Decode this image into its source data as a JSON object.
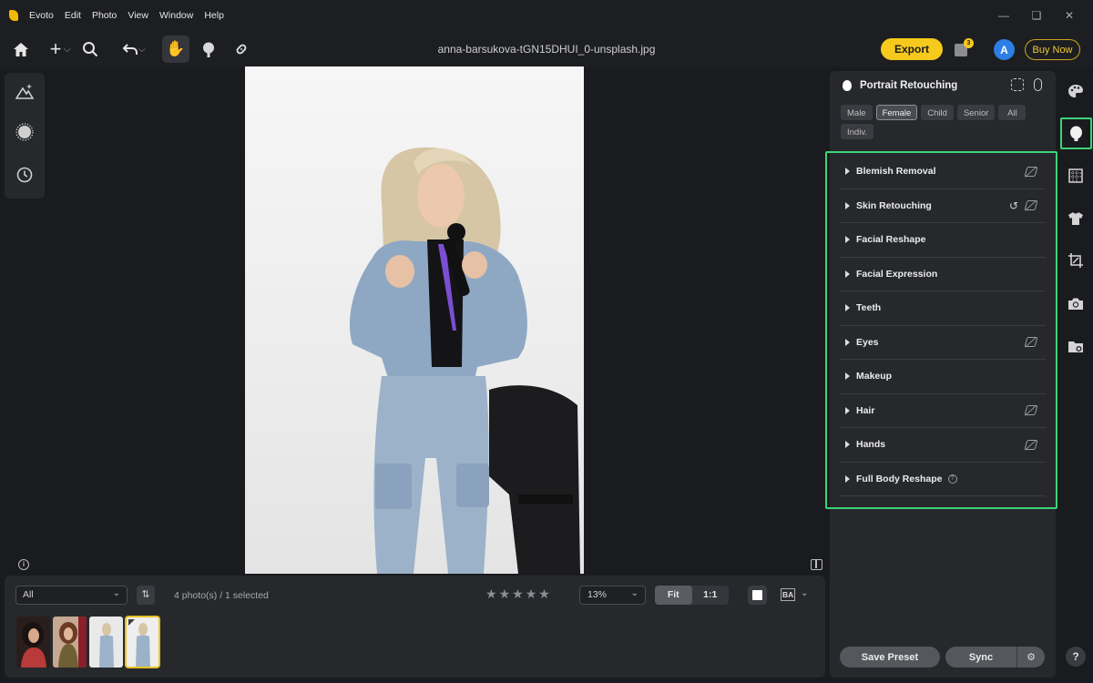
{
  "app": {
    "menu": [
      "Evoto",
      "Edit",
      "Photo",
      "View",
      "Window",
      "Help"
    ],
    "window_controls": [
      "minimize-icon",
      "restore-icon",
      "close-icon"
    ]
  },
  "toolbar": {
    "filename": "anna-barsukova-tGN15DHUI_0-unsplash.jpg",
    "export_label": "Export",
    "queue_badge": "3",
    "avatar_letter": "A",
    "buy_now_label": "Buy Now",
    "brand_color": "#f6c91d"
  },
  "bottom": {
    "filter_value": "All",
    "count_text": "4 photo(s) / 1 selected",
    "rating_stars": 5,
    "zoom_value": "13%",
    "fit_label": "Fit",
    "one_to_one_label": "1:1",
    "ba_label": "BA",
    "thumbnails": 4,
    "selected_thumbnail": 4
  },
  "panel": {
    "title": "Portrait Retouching",
    "filters": [
      {
        "label": "Male",
        "active": false
      },
      {
        "label": "Female",
        "active": true
      },
      {
        "label": "Child",
        "active": false
      },
      {
        "label": "Senior",
        "active": false
      },
      {
        "label": "All",
        "active": false
      },
      {
        "label": "Indiv.",
        "active": false
      }
    ],
    "sections": [
      {
        "label": "Blemish Removal",
        "erase": true,
        "reset": false,
        "help": false
      },
      {
        "label": "Skin Retouching",
        "erase": true,
        "reset": true,
        "help": false
      },
      {
        "label": "Facial Reshape",
        "erase": false,
        "reset": false,
        "help": false
      },
      {
        "label": "Facial Expression",
        "erase": false,
        "reset": false,
        "help": false
      },
      {
        "label": "Teeth",
        "erase": false,
        "reset": false,
        "help": false
      },
      {
        "label": "Eyes",
        "erase": true,
        "reset": false,
        "help": false
      },
      {
        "label": "Makeup",
        "erase": false,
        "reset": false,
        "help": false
      },
      {
        "label": "Hair",
        "erase": true,
        "reset": false,
        "help": false
      },
      {
        "label": "Hands",
        "erase": true,
        "reset": false,
        "help": false
      },
      {
        "label": "Full Body Reshape",
        "erase": false,
        "reset": false,
        "help": true
      }
    ],
    "save_preset_label": "Save Preset",
    "sync_label": "Sync",
    "highlight_color": "#3dd27a"
  },
  "rail": {
    "icons": [
      "palette-icon",
      "face-icon",
      "background-icon",
      "clothing-icon",
      "crop-icon",
      "camera-icon",
      "folder-icon"
    ],
    "selected": "face-icon"
  }
}
